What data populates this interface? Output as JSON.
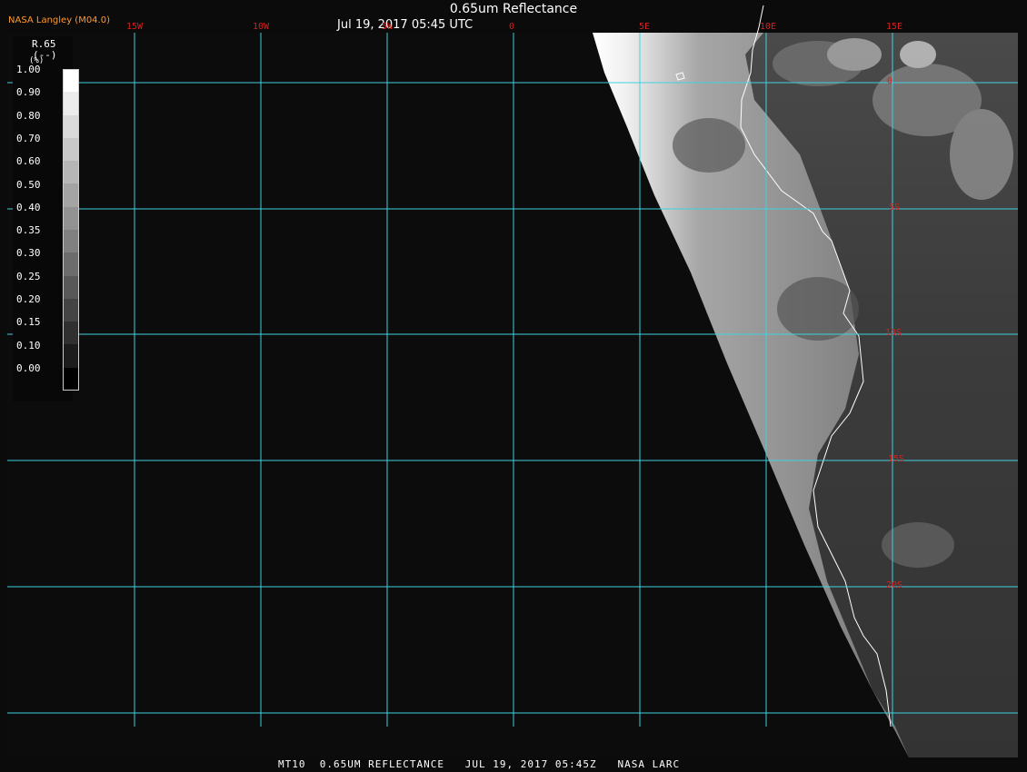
{
  "header": {
    "organization": "NASA Langley (M04.0)",
    "title": "0.65um Reflectance",
    "datetime": "Jul 19, 2017 05:45 UTC"
  },
  "footer": {
    "text": "MT10  0.65UM REFLECTANCE   JUL 19, 2017 05:45Z   NASA LARC"
  },
  "legend": {
    "variable": "R.65",
    "units": "(--)",
    "axis_char": "(%)",
    "levels": [
      "1.00",
      "0.90",
      "0.80",
      "0.70",
      "0.60",
      "0.50",
      "0.40",
      "0.35",
      "0.30",
      "0.25",
      "0.20",
      "0.15",
      "0.10",
      "0.00"
    ],
    "colors": [
      "#ffffff",
      "#ececec",
      "#dadada",
      "#c8c8c8",
      "#b6b6b6",
      "#a4a4a4",
      "#929292",
      "#808080",
      "#6c6c6c",
      "#585858",
      "#444444",
      "#303030",
      "#1c1c1c",
      "#000000"
    ]
  },
  "grid": {
    "lon_labels": [
      "15W",
      "10W",
      "5W",
      "0",
      "5E",
      "10E",
      "15E"
    ],
    "lat_labels": [
      "0",
      "5S",
      "10S",
      "15S",
      "20S"
    ],
    "color": "#3fd1e0"
  },
  "colors": {
    "label": "#d62020",
    "coast": "#ffffff",
    "ocean": "#0b0b0b"
  }
}
